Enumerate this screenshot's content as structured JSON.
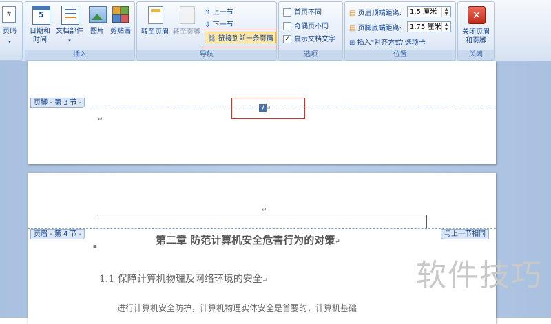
{
  "ribbon": {
    "page_number_label": "页码",
    "insert": {
      "title": "插入",
      "date_time": "日期和\n时间",
      "doc_parts": "文档部件",
      "picture": "图片",
      "clipart": "剪贴画"
    },
    "nav": {
      "title": "导航",
      "goto_header": "转至页眉",
      "goto_footer": "转至页脚",
      "prev_section": "上一节",
      "next_section": "下一节",
      "link_previous": "链接到前一条页眉"
    },
    "options": {
      "title": "选项",
      "diff_first": "首页不同",
      "diff_odd_even": "奇偶页不同",
      "show_doc_text": "显示文档文字",
      "show_doc_text_checked": "✓"
    },
    "position": {
      "title": "位置",
      "header_top_label": "页眉顶端距离:",
      "header_top_value": "1.5 厘米",
      "footer_bottom_label": "页脚底端距离:",
      "footer_bottom_value": "1.75 厘米",
      "insert_align_tab": "插入\"对齐方式\"选项卡"
    },
    "close": {
      "title": "关闭",
      "close_label": "关闭页眉\n和页脚"
    }
  },
  "document": {
    "footer_tag": "页脚 - 第 3 节 -",
    "page_number": "7",
    "header_tag": "页眉 - 第 4 节 -",
    "same_as_previous": "与上一节相同",
    "chapter_title": "第二章 防范计算机安全危害行为的对策",
    "section_heading": "1.1 保障计算机物理及网络环境的安全",
    "body_line": "进行计算机安全防护，计算机物理实体安全是首要的，计算机基础",
    "para_mark": "↵"
  },
  "watermark": "软件技巧"
}
